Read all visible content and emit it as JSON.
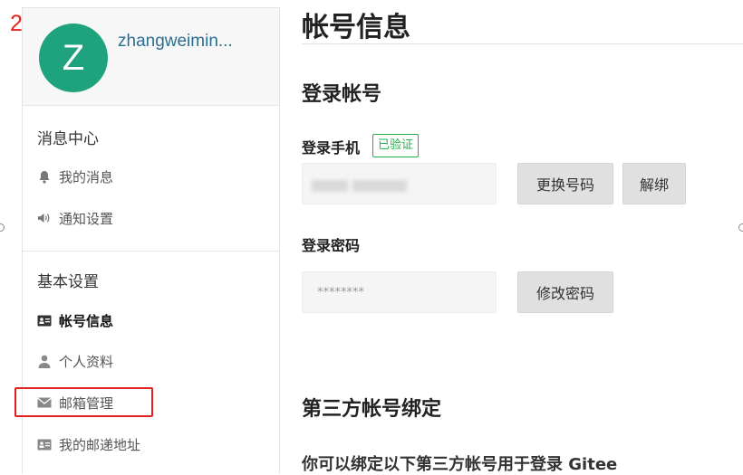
{
  "annotation": {
    "step_number": "2",
    "marker_color": "#e41f1f"
  },
  "sidebar": {
    "username": "zhangweimin...",
    "avatar_letter": "Z",
    "avatar_color": "#1fa27e",
    "messages_section": {
      "title": "消息中心",
      "items": [
        {
          "label": "我的消息",
          "icon": "bell-icon"
        },
        {
          "label": "通知设置",
          "icon": "speaker-icon"
        }
      ]
    },
    "settings_section": {
      "title": "基本设置",
      "items": [
        {
          "label": "帐号信息",
          "icon": "id-card-icon",
          "active": true
        },
        {
          "label": "个人资料",
          "icon": "user-icon"
        },
        {
          "label": "邮箱管理",
          "icon": "envelope-icon",
          "highlighted": true
        },
        {
          "label": "我的邮递地址",
          "icon": "address-card-icon"
        }
      ]
    }
  },
  "main": {
    "page_title": "帐号信息",
    "login_account": {
      "heading": "登录帐号",
      "phone_label": "登录手机",
      "verified_badge": "已验证",
      "phone_value_hidden": true,
      "change_number_button": "更换号码",
      "unbind_button": "解绑",
      "password_label": "登录密码",
      "password_value": "********",
      "change_password_button": "修改密码"
    },
    "third_party": {
      "heading": "第三方帐号绑定",
      "description": "你可以绑定以下第三方帐号用于登录 Gitee"
    }
  },
  "colors": {
    "accent_green": "#21b14a",
    "link_blue": "#2b6e8f"
  }
}
